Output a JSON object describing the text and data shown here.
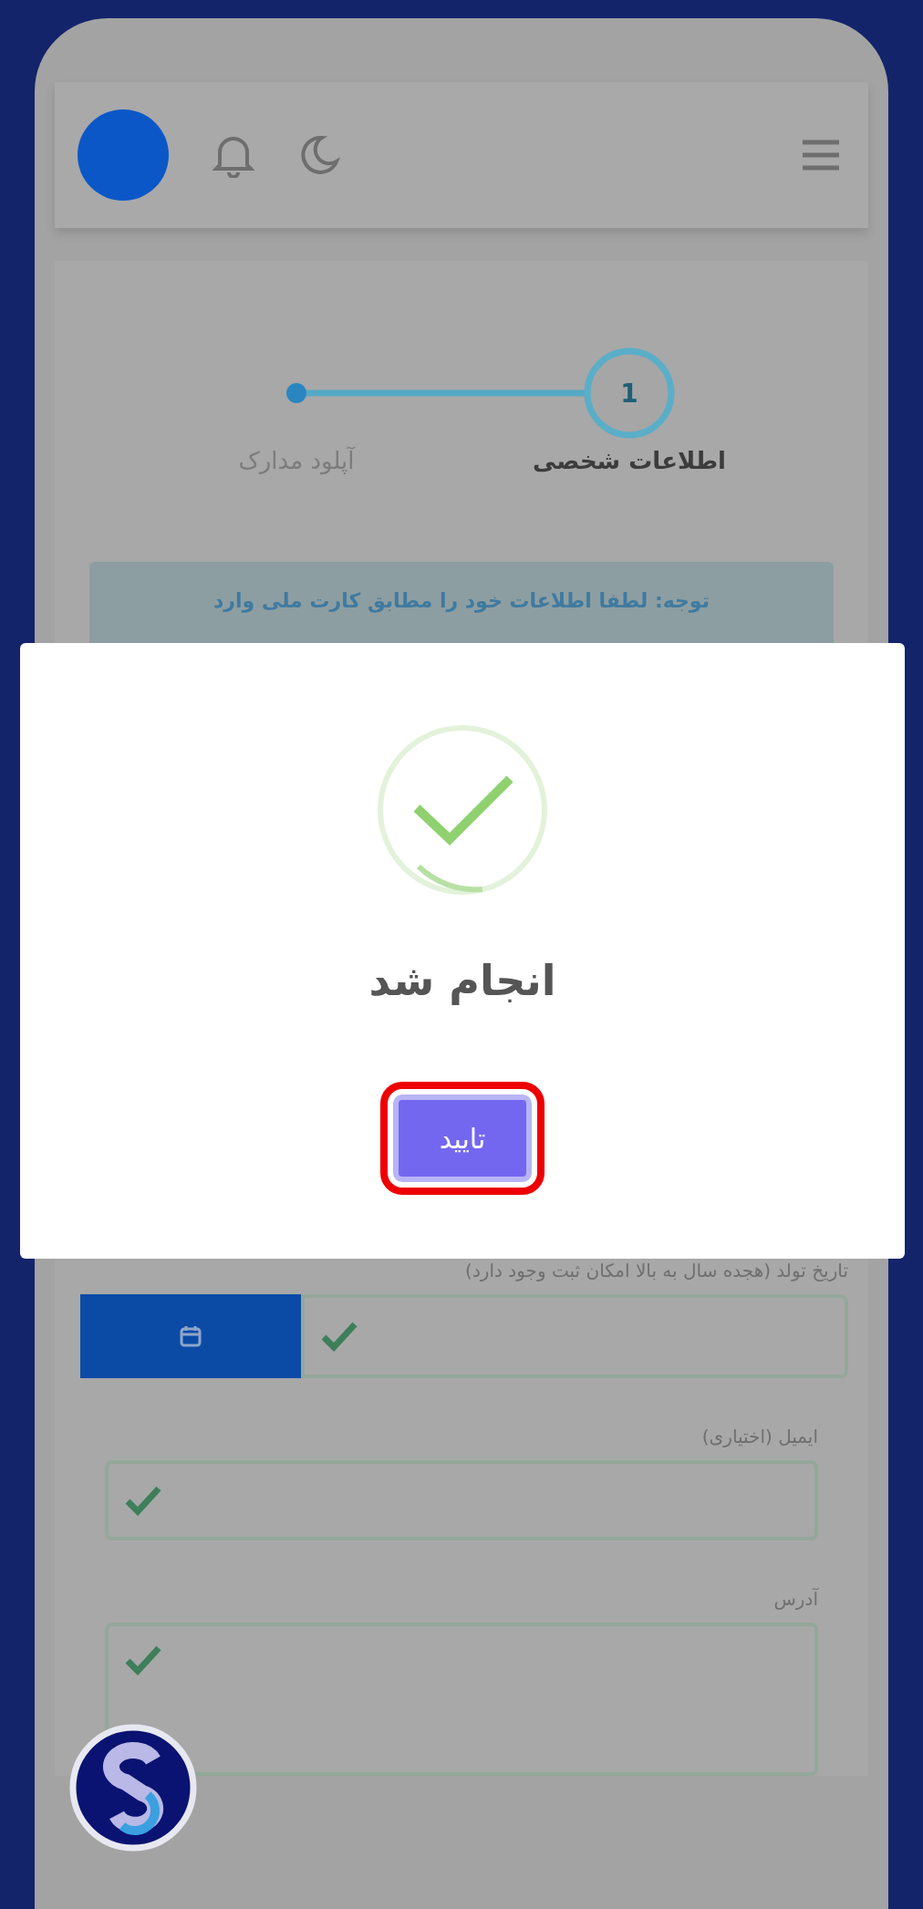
{
  "stepper": {
    "steps": [
      {
        "number": "1",
        "label": "اطلاعات شخصی",
        "selected": true
      },
      {
        "label": "آپلود مدارک",
        "selected": false
      }
    ]
  },
  "alert": {
    "text": "توجه: لطفا اطلاعات خود را مطابق کارت ملی وارد"
  },
  "form": {
    "fields": [
      {
        "kind": "date",
        "label": "تاریخ تولد (هجده سال به بالا امکان ثبت وجود دارد)",
        "valid": true
      },
      {
        "kind": "text",
        "label": "ایمیل (اختیاری)",
        "valid": true
      },
      {
        "kind": "textarea",
        "label": "آدرس",
        "valid": true
      }
    ]
  },
  "modal": {
    "success": true,
    "title": "انجام شد",
    "button": "تایید",
    "highlighted": true
  }
}
